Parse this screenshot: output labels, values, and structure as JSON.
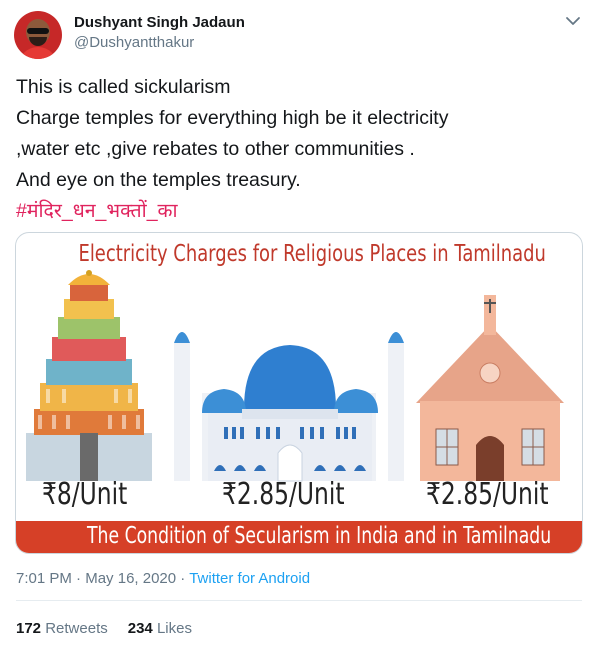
{
  "author": {
    "name": "Dushyant Singh Jadaun",
    "handle": "@Dushyantthakur"
  },
  "tweet": {
    "lines": [
      "This is called sickularism",
      "Charge temples for everything  high be it electricity",
      ",water etc ,give rebates to other communities .",
      "And eye on the temples treasury."
    ],
    "hashtag": "#मंदिर_धन_भक्तों_का"
  },
  "image": {
    "title": "Electricity Charges for Religious Places in Tamilnadu",
    "prices": {
      "temple": "₹8/Unit",
      "mosque": "₹2.85/Unit",
      "church": "₹2.85/Unit"
    },
    "banner": "The Condition of Secularism in India and in Tamilnadu"
  },
  "meta": {
    "time": "7:01 PM",
    "separator1": " · ",
    "date": "May 16, 2020",
    "separator2": " · ",
    "source": "Twitter for Android"
  },
  "stats": {
    "retweets_count": "172",
    "retweets_label": "Retweets",
    "likes_count": "234",
    "likes_label": "Likes"
  },
  "colors": {
    "link": "#1da1f2",
    "hashtag": "#e0245e",
    "banner": "#d64027",
    "title": "#c0392b"
  },
  "icons": {
    "menu": "chevron-down-icon"
  }
}
